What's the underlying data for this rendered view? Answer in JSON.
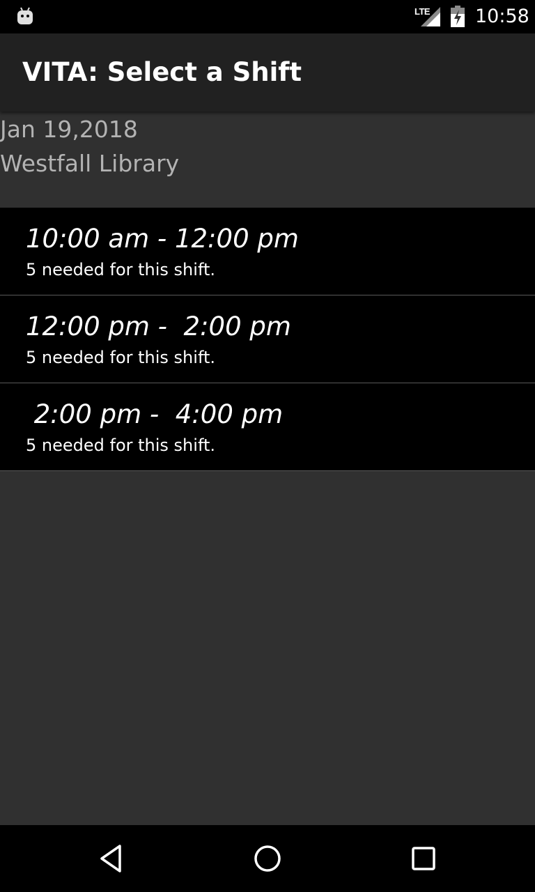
{
  "status_bar": {
    "time": "10:58",
    "network_label": "LTE",
    "icons": [
      "android-icon",
      "signal-icon",
      "battery-icon"
    ]
  },
  "app_bar": {
    "title": "VITA: Select a Shift"
  },
  "info": {
    "date": "Jan 19,2018",
    "location": "Westfall Library"
  },
  "shifts": [
    {
      "time": "10:00 am - 12:00 pm",
      "needed": "5 needed for this shift."
    },
    {
      "time": "12:00 pm -  2:00 pm",
      "needed": "5 needed for this shift."
    },
    {
      "time": " 2:00 pm -  4:00 pm",
      "needed": "5 needed for this shift."
    }
  ],
  "nav_bar": {
    "icons": [
      "back-icon",
      "home-icon",
      "recents-icon"
    ]
  },
  "colors": {
    "status_bar_bg": "#000000",
    "app_bar_bg": "#212121",
    "content_bg": "#303030",
    "list_bg": "#000000",
    "primary_text": "#ffffff",
    "secondary_text": "#b3b3b3"
  }
}
